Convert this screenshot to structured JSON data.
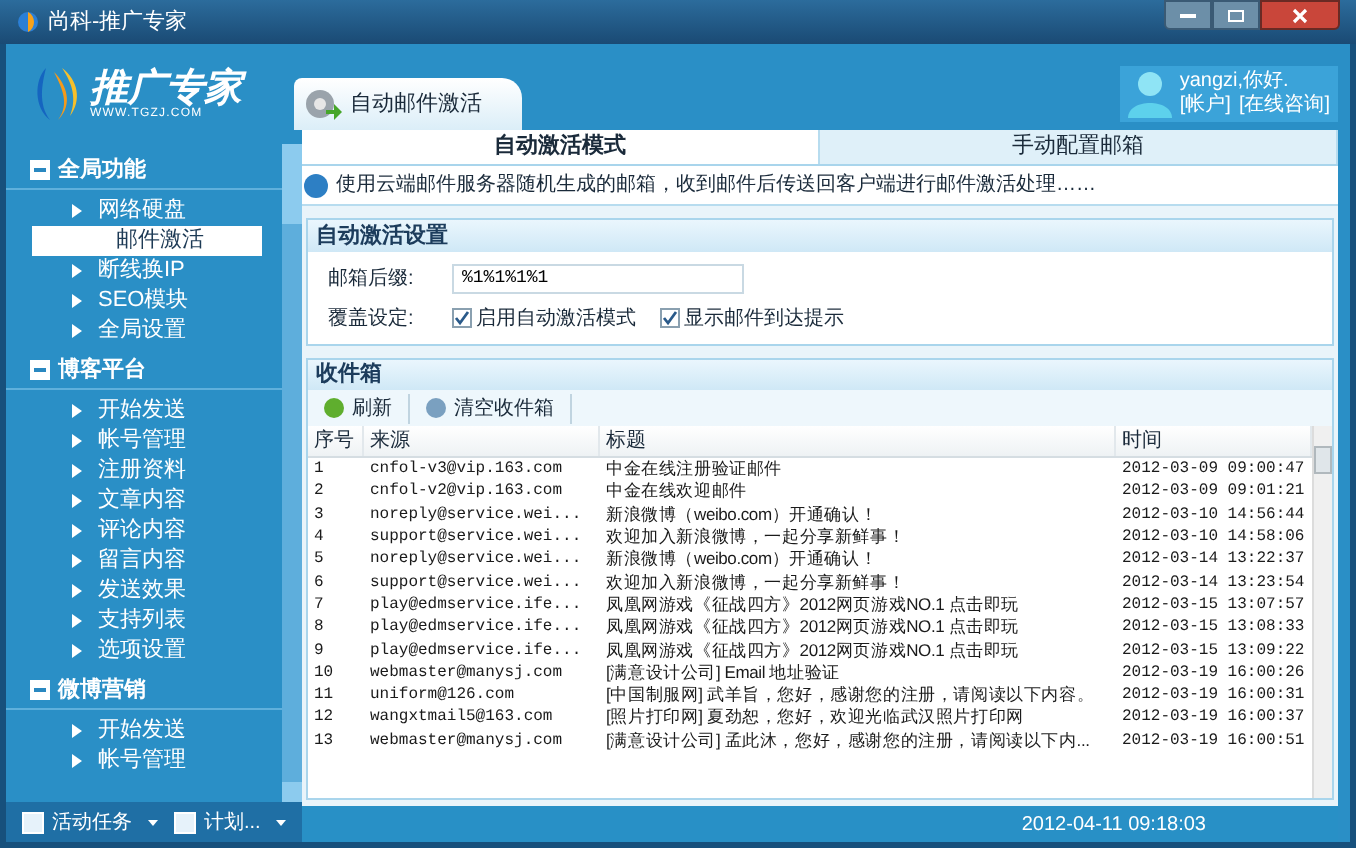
{
  "window": {
    "title": "尚科-推广专家"
  },
  "logo": {
    "name": "推广专家",
    "url": "WWW.TGZJ.COM"
  },
  "user": {
    "greeting": "yangzi,你好.",
    "links": [
      "[帐户]",
      "[在线咨询]"
    ]
  },
  "sidebar": {
    "groups": [
      {
        "label": "全局功能",
        "expanded": true,
        "items": [
          {
            "label": "网络硬盘",
            "selected": false
          },
          {
            "label": "邮件激活",
            "selected": true
          },
          {
            "label": "断线换IP",
            "selected": false
          },
          {
            "label": "SEO模块",
            "selected": false
          },
          {
            "label": "全局设置",
            "selected": false
          }
        ]
      },
      {
        "label": "博客平台",
        "expanded": true,
        "items": [
          {
            "label": "开始发送",
            "selected": false
          },
          {
            "label": "帐号管理",
            "selected": false
          },
          {
            "label": "注册资料",
            "selected": false
          },
          {
            "label": "文章内容",
            "selected": false
          },
          {
            "label": "评论内容",
            "selected": false
          },
          {
            "label": "留言内容",
            "selected": false
          },
          {
            "label": "发送效果",
            "selected": false
          },
          {
            "label": "支持列表",
            "selected": false
          },
          {
            "label": "选项设置",
            "selected": false
          }
        ]
      },
      {
        "label": "微博营销",
        "expanded": true,
        "items": [
          {
            "label": "开始发送",
            "selected": false
          },
          {
            "label": "帐号管理",
            "selected": false
          }
        ]
      }
    ],
    "bottom_buttons": [
      "活动任务",
      "计划..."
    ]
  },
  "main_tab": {
    "label": "自动邮件激活"
  },
  "subtabs": [
    {
      "label": "自动激活模式",
      "selected": true
    },
    {
      "label": "手动配置邮箱",
      "selected": false
    }
  ],
  "info": "使用云端邮件服务器随机生成的邮箱，收到邮件后传送回客户端进行邮件激活处理……",
  "settings": {
    "title": "自动激活设置",
    "fields": [
      {
        "kind": "text",
        "label": "邮箱后缀:",
        "value": "%1%1%1%1"
      },
      {
        "kind": "checks",
        "label": "覆盖设定:",
        "options": [
          {
            "label": "启用自动激活模式",
            "checked": true
          },
          {
            "label": "显示邮件到达提示",
            "checked": true
          }
        ]
      }
    ]
  },
  "inbox": {
    "title": "收件箱",
    "toolbar": [
      "刷新",
      "清空收件箱"
    ],
    "columns": [
      "序号",
      "来源",
      "标题",
      "时间"
    ],
    "rows": [
      [
        "1",
        "cnfol-v3@vip.163.com",
        "中金在线注册验证邮件",
        "2012-03-09 09:00:47"
      ],
      [
        "2",
        "cnfol-v2@vip.163.com",
        "中金在线欢迎邮件",
        "2012-03-09 09:01:21"
      ],
      [
        "3",
        "noreply@service.wei...",
        "新浪微博（weibo.com）开通确认！",
        "2012-03-10 14:56:44"
      ],
      [
        "4",
        "support@service.wei...",
        "欢迎加入新浪微博，一起分享新鲜事！",
        "2012-03-10 14:58:06"
      ],
      [
        "5",
        "noreply@service.wei...",
        "新浪微博（weibo.com）开通确认！",
        "2012-03-14 13:22:37"
      ],
      [
        "6",
        "support@service.wei...",
        "欢迎加入新浪微博，一起分享新鲜事！",
        "2012-03-14 13:23:54"
      ],
      [
        "7",
        "play@edmservice.ife...",
        "凤凰网游戏《征战四方》2012网页游戏NO.1 点击即玩",
        "2012-03-15 13:07:57"
      ],
      [
        "8",
        "play@edmservice.ife...",
        "凤凰网游戏《征战四方》2012网页游戏NO.1 点击即玩",
        "2012-03-15 13:08:33"
      ],
      [
        "9",
        "play@edmservice.ife...",
        "凤凰网游戏《征战四方》2012网页游戏NO.1 点击即玩",
        "2012-03-15 13:09:22"
      ],
      [
        "10",
        "webmaster@manysj.com",
        "[满意设计公司] Email 地址验证",
        "2012-03-19 16:00:26"
      ],
      [
        "11",
        "uniform@126.com",
        "[中国制服网] 武羊旨，您好，感谢您的注册，请阅读以下内容。",
        "2012-03-19 16:00:31"
      ],
      [
        "12",
        "wangxtmail5@163.com",
        "[照片打印网] 夏劲恕，您好，欢迎光临武汉照片打印网",
        "2012-03-19 16:00:37"
      ],
      [
        "13",
        "webmaster@manysj.com",
        "[满意设计公司] 孟此沐，您好，感谢您的注册，请阅读以下内...",
        "2012-03-19 16:00:51"
      ]
    ]
  },
  "status_bar": {
    "time": "2012-04-11 09:18:03"
  }
}
